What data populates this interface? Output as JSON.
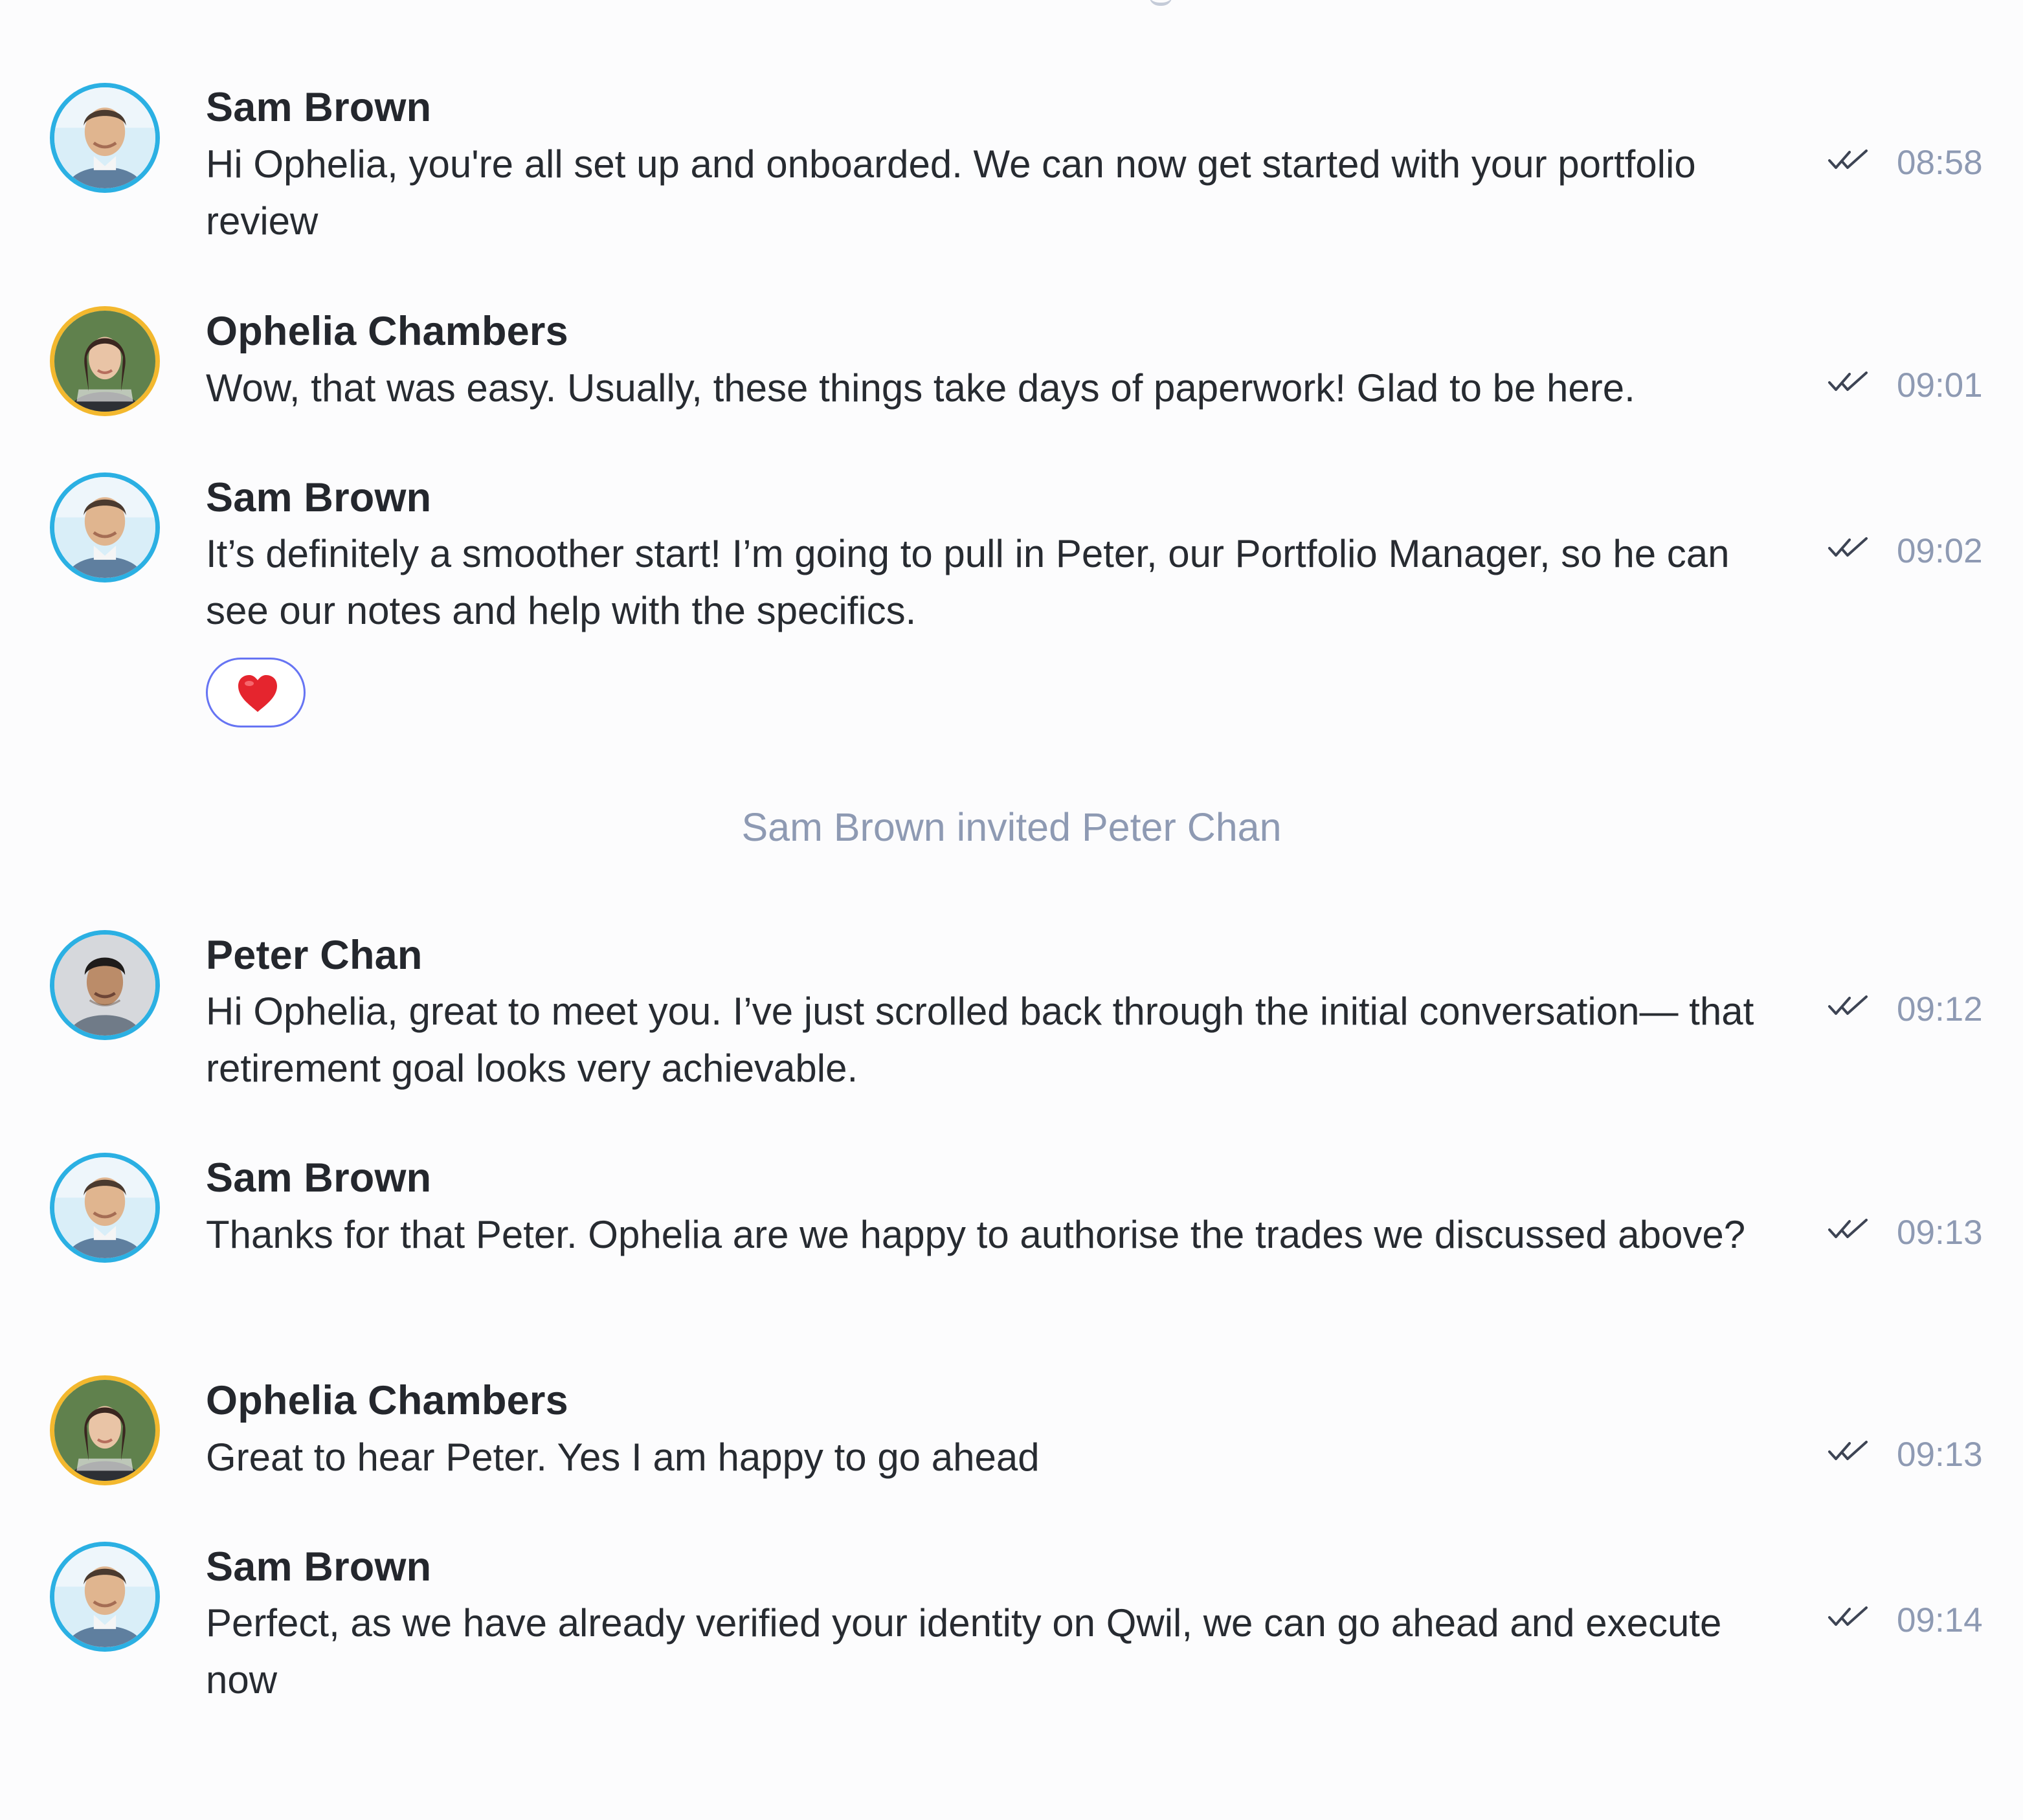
{
  "conversation": {
    "messages": [
      {
        "sender": "Sam Brown",
        "text": "Hi Ophelia, you're all set up and onboarded. We can now get started with your portfolio review",
        "time": "08:58",
        "avatar": "sam-brown-avatar",
        "ring_color": "#2bb0e3"
      },
      {
        "sender": "Ophelia Chambers",
        "text": "Wow, that was easy. Usually, these things take days of paperwork! Glad to be here.",
        "time": "09:01",
        "avatar": "ophelia-chambers-avatar",
        "ring_color": "#f3b82e"
      },
      {
        "sender": "Sam Brown",
        "text": "It’s definitely a smoother start! I’m going to pull in Peter, our Portfolio Manager, so he can see our notes and help with the specifics.",
        "time": "09:02",
        "avatar": "sam-brown-avatar",
        "ring_color": "#2bb0e3",
        "reaction": "heart-emoji"
      },
      {
        "sender": "Peter Chan",
        "text": "Hi Ophelia, great to meet you. I’ve just scrolled back through the initial conversation— that retirement goal looks very achievable.",
        "time": "09:12",
        "avatar": "peter-chan-avatar",
        "ring_color": "#2bb0e3"
      },
      {
        "sender": "Sam Brown",
        "text": "Thanks for that Peter. Ophelia are we happy to authorise the trades we discussed above?",
        "time": "09:13",
        "avatar": "sam-brown-avatar",
        "ring_color": "#2bb0e3"
      },
      {
        "sender": "Ophelia Chambers",
        "text": "Great to hear Peter. Yes I am happy to go ahead",
        "time": "09:13",
        "avatar": "ophelia-chambers-avatar",
        "ring_color": "#f3b82e"
      },
      {
        "sender": "Sam Brown",
        "text": "Perfect, as we have already verified your identity on Qwil, we can go ahead and execute now",
        "time": "09:14",
        "avatar": "sam-brown-avatar",
        "ring_color": "#2bb0e3"
      }
    ],
    "system_note": "Sam Brown invited Peter Chan",
    "receipt_icon": "double-check-icon",
    "colors": {
      "time": "#8e9ab3",
      "reaction_border": "#6674f3",
      "heart": "#e5252e"
    }
  }
}
